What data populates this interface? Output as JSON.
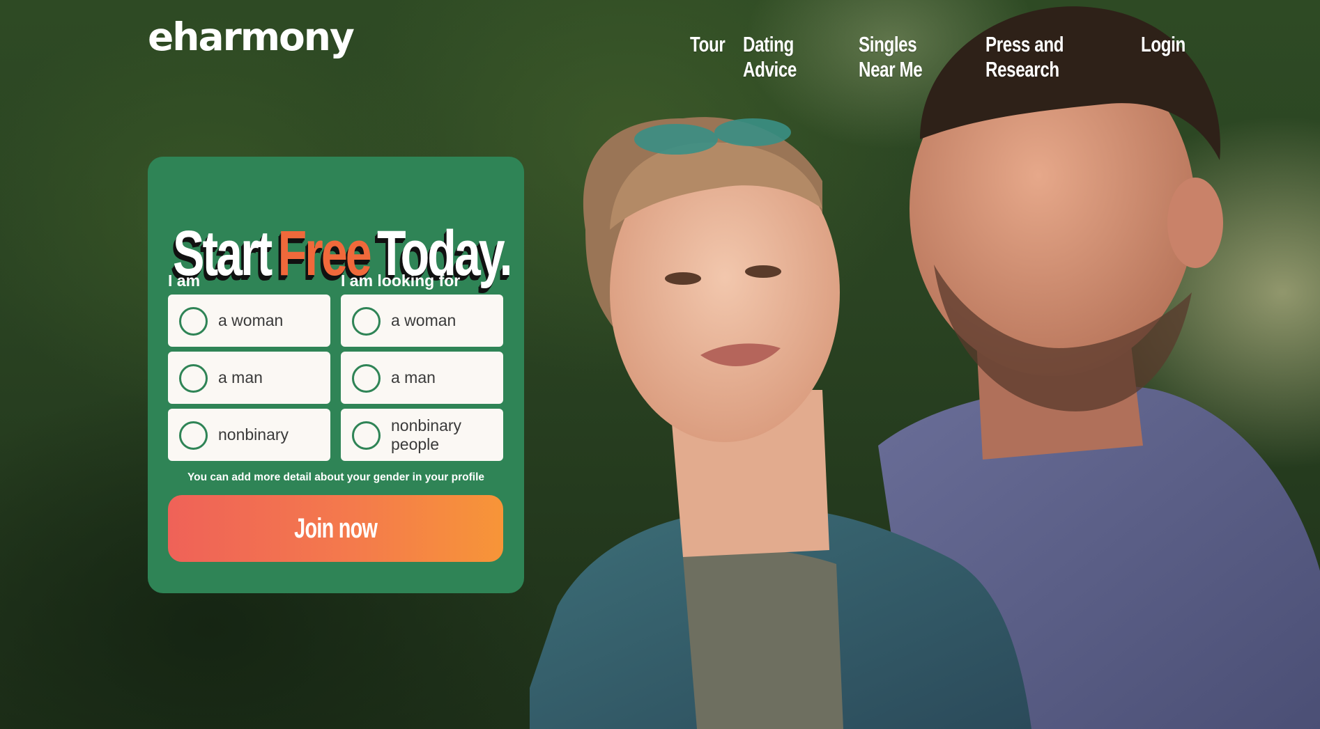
{
  "brand": {
    "logo_text": "eharmony"
  },
  "nav": {
    "items": [
      {
        "label": "Tour"
      },
      {
        "label": "Dating Advice"
      },
      {
        "label": "Singles Near Me"
      },
      {
        "label": "Press and Research"
      },
      {
        "label": "Login"
      }
    ]
  },
  "signup": {
    "headline": {
      "part1": "Start",
      "highlight": "Free",
      "part2": "Today."
    },
    "i_am": {
      "label": "I am",
      "options": [
        {
          "label": "a woman",
          "selected": false
        },
        {
          "label": "a man",
          "selected": false
        },
        {
          "label": "nonbinary",
          "selected": false
        }
      ]
    },
    "looking_for": {
      "label": "I am looking for",
      "options": [
        {
          "label": "a woman",
          "selected": false
        },
        {
          "label": "a man",
          "selected": false
        },
        {
          "label": "nonbinary people",
          "selected": false
        }
      ]
    },
    "hint": "You can add more detail about your gender in your profile",
    "join_button": "Join now"
  },
  "colors": {
    "card_green": "#2f8456",
    "accent_orange": "#f0693b",
    "button_gradient_start": "#ef6258",
    "button_gradient_end": "#f79538"
  },
  "hero": {
    "icon": "couple-photo"
  }
}
